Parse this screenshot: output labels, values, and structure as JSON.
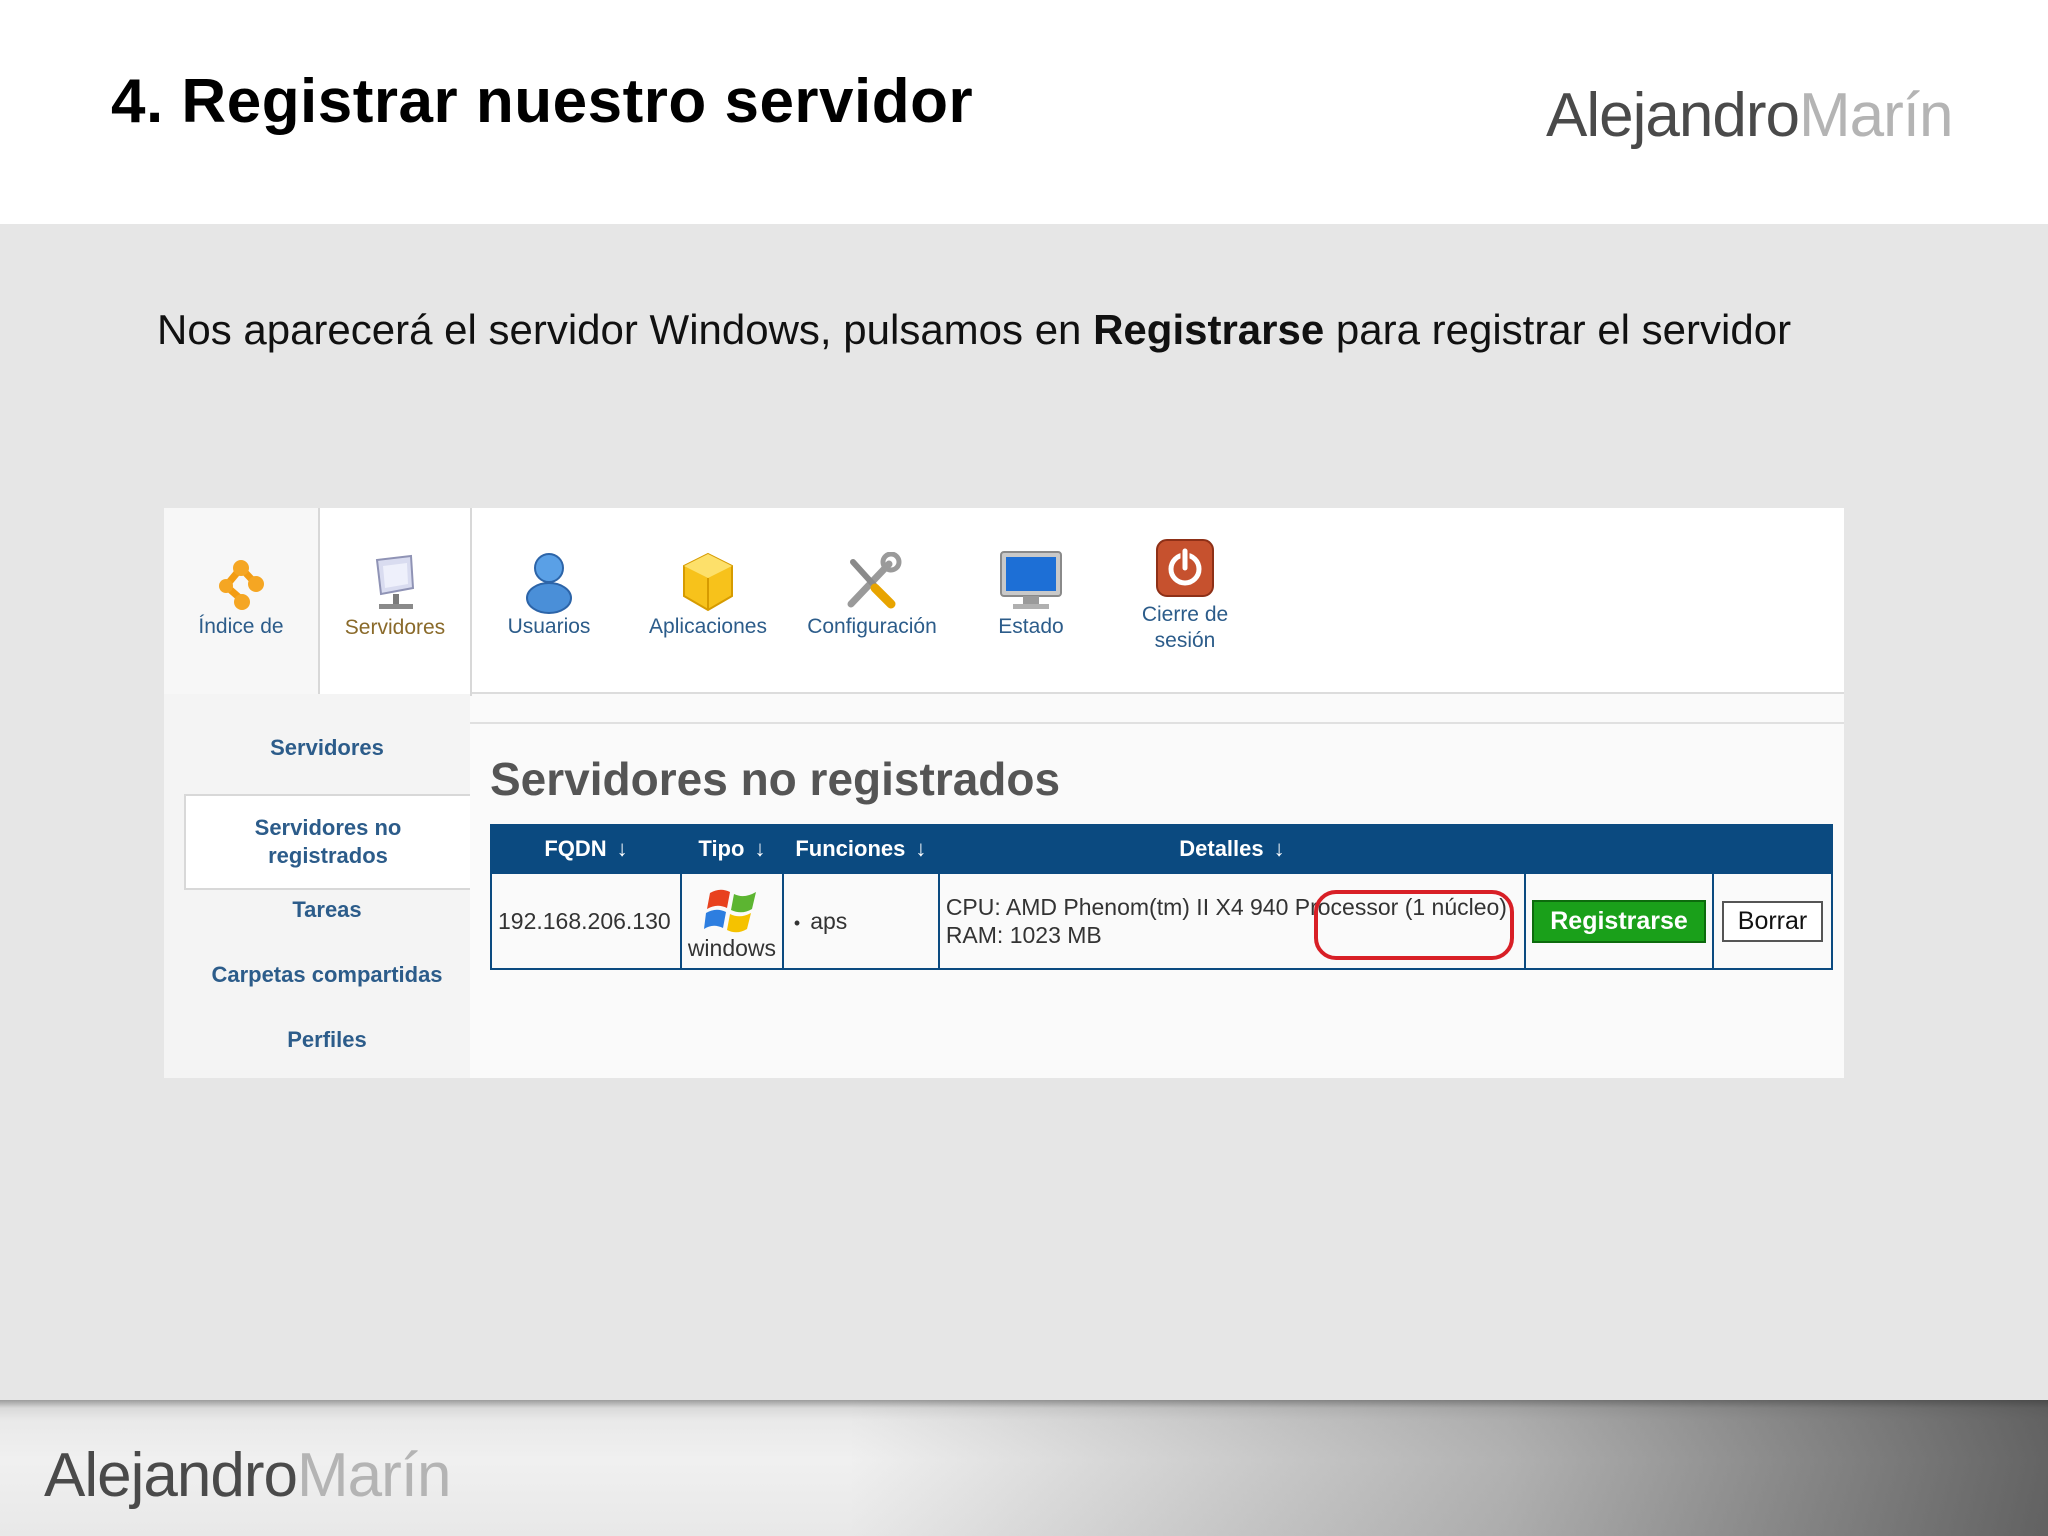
{
  "slide": {
    "title": "4. Registrar nuestro servidor",
    "brand_part1": "Alejandro",
    "brand_part2": "Marín",
    "intro_before": "Nos aparecerá el servidor Windows, pulsamos en ",
    "intro_bold": "Registrarse",
    "intro_after": " para registrar el servidor"
  },
  "app": {
    "nav": [
      {
        "label": "Índice de",
        "icon": "home-node-icon"
      },
      {
        "label": "Servidores",
        "icon": "server-icon"
      },
      {
        "label": "Usuarios",
        "icon": "user-icon"
      },
      {
        "label": "Aplicaciones",
        "icon": "package-icon"
      },
      {
        "label": "Configuración",
        "icon": "tools-icon"
      },
      {
        "label": "Estado",
        "icon": "monitor-icon"
      },
      {
        "label": "Cierre de sesión",
        "icon": "power-icon"
      }
    ],
    "sidebar": [
      {
        "label": "Servidores"
      },
      {
        "label": "Servidores no registrados"
      },
      {
        "label": "Tareas"
      },
      {
        "label": "Carpetas compartidas"
      },
      {
        "label": "Perfiles"
      }
    ],
    "content_title": "Servidores no registrados",
    "table": {
      "headers": [
        "FQDN",
        "Tipo",
        "Funciones",
        "Detalles"
      ],
      "sort_arrow": "↓",
      "rows": [
        {
          "fqdn": "192.168.206.130",
          "tipo": "windows",
          "funciones": "aps",
          "cpu": "CPU: AMD Phenom(tm) II X4 940 Processor (1 núcleo)",
          "ram": "RAM: 1023 MB",
          "register_label": "Registrarse",
          "delete_label": "Borrar"
        }
      ]
    },
    "colors": {
      "header_blue": "#0b4a80",
      "register_green": "#1aa01a",
      "highlight_red": "#d81f26",
      "nav_text": "#2c5c8a"
    }
  }
}
